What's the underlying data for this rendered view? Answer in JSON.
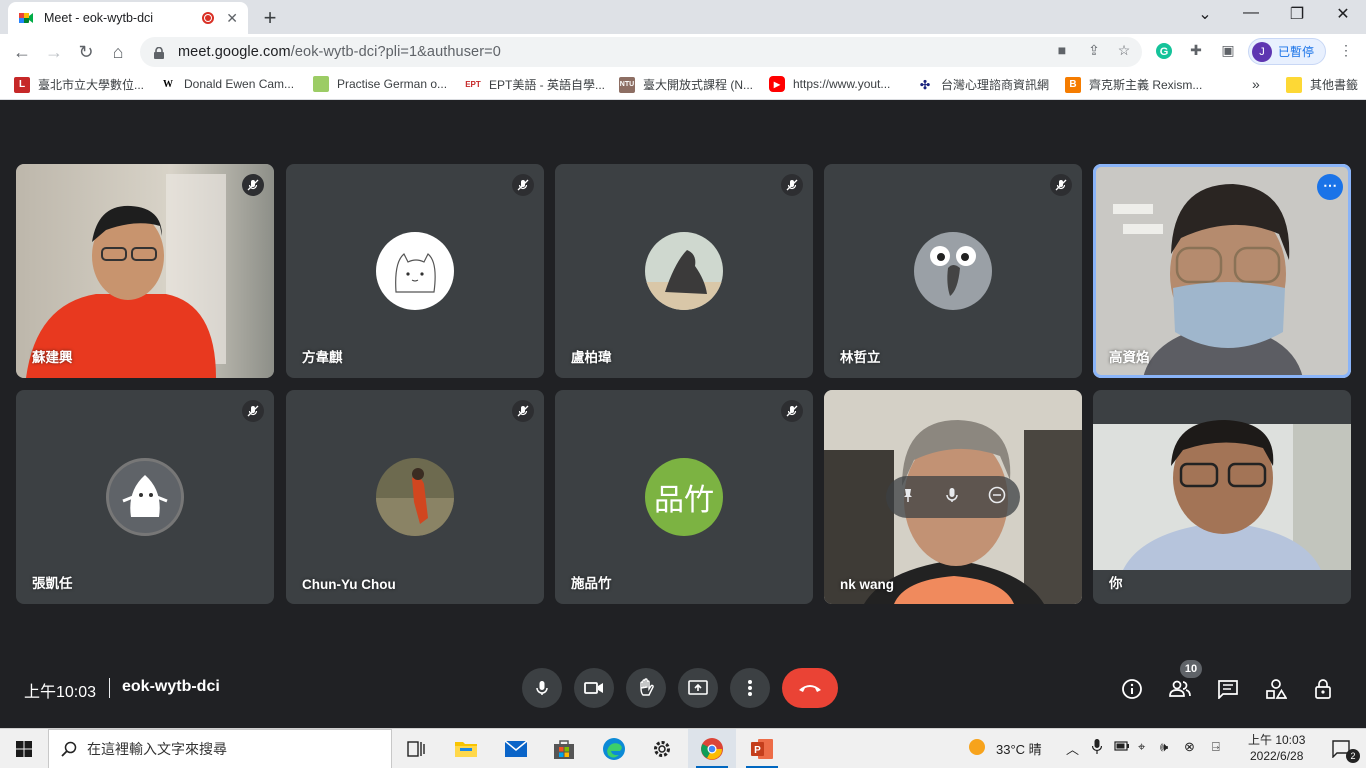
{
  "browser": {
    "tab_title": "Meet - eok-wytb-dci",
    "url_host": "meet.google.com",
    "url_path": "/eok-wytb-dci?pli=1&authuser=0",
    "profile_initial": "J",
    "profile_label": "已暫停",
    "bookmarks": [
      "臺北市立大學數位...",
      "Donald Ewen Cam...",
      "Practise German o...",
      "EPT美語 - 英語自學...",
      "臺大開放式課程 (N...",
      "https://www.yout...",
      "台灣心理諮商資訊網",
      "齊克斯主義 Rexism..."
    ],
    "bookmarks_overflow": "»",
    "other_bookmarks": "其他書籤"
  },
  "meet": {
    "participants": [
      {
        "name": "蘇建興",
        "muted": true,
        "video": true
      },
      {
        "name": "方韋麒",
        "muted": true,
        "video": false
      },
      {
        "name": "盧柏瑋",
        "muted": true,
        "video": false
      },
      {
        "name": "林哲立",
        "muted": true,
        "video": false
      },
      {
        "name": "高資焰",
        "muted": false,
        "video": true,
        "active": true
      },
      {
        "name": "張凱任",
        "muted": true,
        "video": false
      },
      {
        "name": "Chun-Yu Chou",
        "muted": true,
        "video": false
      },
      {
        "name": "施品竹",
        "muted": true,
        "video": false,
        "initials": "品竹"
      },
      {
        "name": "nk wang",
        "muted": false,
        "video": true
      },
      {
        "name": "你",
        "muted": false,
        "video": true
      }
    ],
    "clock": "上午10:03",
    "meeting_code": "eok-wytb-dci",
    "participant_count": "10",
    "more_icon": "⋯",
    "colors": {
      "end_call": "#ea4335",
      "active_outline": "#8ab4f8",
      "initials_bg": "#7cb342"
    }
  },
  "taskbar": {
    "search_placeholder": "在這裡輸入文字來搜尋",
    "weather": "33°C 晴",
    "time": "上午 10:03",
    "date": "2022/6/28",
    "notifications": "2"
  }
}
